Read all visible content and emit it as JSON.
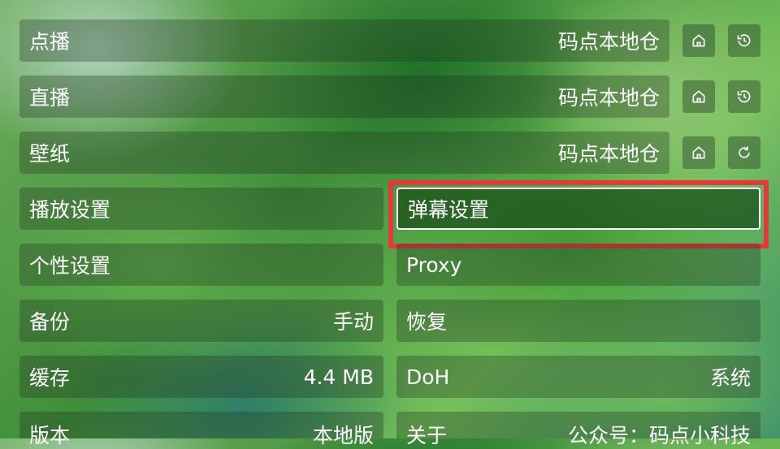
{
  "rows": {
    "vod": {
      "label": "点播",
      "value": "码点本地仓"
    },
    "live": {
      "label": "直播",
      "value": "码点本地仓"
    },
    "wallpaper": {
      "label": "壁纸",
      "value": "码点本地仓"
    },
    "playback_settings": {
      "label": "播放设置"
    },
    "danmaku_settings": {
      "label": "弹幕设置"
    },
    "personal_settings": {
      "label": "个性设置"
    },
    "proxy": {
      "label": "Proxy"
    },
    "backup": {
      "label": "备份",
      "value": "手动"
    },
    "restore": {
      "label": "恢复"
    },
    "cache": {
      "label": "缓存",
      "value": "4.4 MB"
    },
    "doh": {
      "label": "DoH",
      "value": "系统"
    },
    "version": {
      "label": "版本",
      "value": "本地版"
    },
    "about": {
      "label": "关于",
      "value": "公众号：码点小科技"
    }
  },
  "icons": {
    "home": "home-icon",
    "history": "history-icon",
    "refresh": "refresh-icon"
  },
  "colors": {
    "highlight_border": "#e23a3a",
    "focus_border": "#ffffff"
  }
}
